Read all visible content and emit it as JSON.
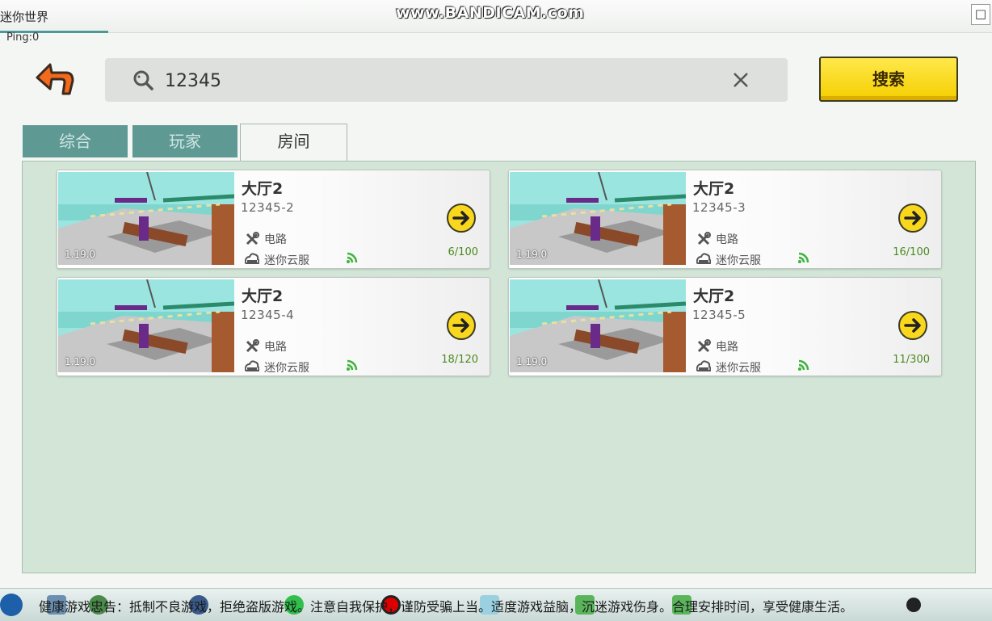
{
  "window": {
    "title": "迷你世界",
    "watermark": "www.BANDICAM.com",
    "close_glyph": "□",
    "ping": "Ping:0"
  },
  "search": {
    "value": "12345",
    "button_label": "搜索"
  },
  "tabs": [
    {
      "label": "综合",
      "active": false
    },
    {
      "label": "玩家",
      "active": false
    },
    {
      "label": "房间",
      "active": true
    }
  ],
  "rooms": [
    {
      "name": "大厅2",
      "room_id": "12345-2",
      "version": "1.19.0",
      "host": "电路",
      "server": "迷你云服",
      "players": "6/100"
    },
    {
      "name": "大厅2",
      "room_id": "12345-3",
      "version": "1.19.0",
      "host": "电路",
      "server": "迷你云服",
      "players": "16/100"
    },
    {
      "name": "大厅2",
      "room_id": "12345-4",
      "version": "1.19.0",
      "host": "电路",
      "server": "迷你云服",
      "players": "18/120"
    },
    {
      "name": "大厅2",
      "room_id": "12345-5",
      "version": "1.19.0",
      "host": "电路",
      "server": "迷你云服",
      "players": "11/300"
    }
  ],
  "taskbar": {
    "ticker": "健康游戏忠告：抵制不良游戏，拒绝盗版游戏。注意自我保护，谨防受骗上当。适度游戏益脑，沉迷游戏伤身。合理安排时间，享受健康生活。"
  },
  "colors": {
    "tab_inactive": "#5f9993",
    "panel_bg": "#d2e5d7",
    "search_button": "#f5cf00",
    "player_count": "#4a8a20"
  },
  "icons": [
    "back-arrow-icon",
    "search-icon",
    "clear-icon",
    "tool-icon",
    "cloud-icon",
    "signal-icon",
    "arrow-right-icon"
  ]
}
